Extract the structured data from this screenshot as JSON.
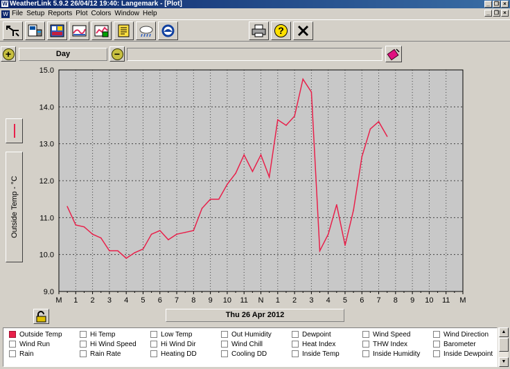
{
  "window": {
    "title": "WeatherLink 5.9.2  26/04/12  19:40: Langemark - [Plot]"
  },
  "menu": [
    "File",
    "Setup",
    "Reports",
    "Plot",
    "Colors",
    "Window",
    "Help"
  ],
  "toolbar": {
    "left_tools": [
      "walk-icon",
      "station-icon",
      "summary-icon",
      "bulletin-icon",
      "plot-icon",
      "notes-icon",
      "forecast-icon",
      "noaa-icon"
    ],
    "right_tools": [
      "print-icon",
      "help-icon",
      "close-icon"
    ],
    "help_glyph": "?",
    "close_glyph": "✕"
  },
  "controls": {
    "zoom_in_glyph": "+",
    "zoom_out_glyph": "−",
    "period": "Day",
    "field_text": ""
  },
  "chart_data": {
    "type": "line",
    "series": [
      {
        "name": "Outside Temp",
        "color": "#e8204a",
        "x_hours": [
          0.5,
          1,
          1.5,
          2,
          2.5,
          3,
          3.5,
          4,
          4.5,
          5,
          5.5,
          6,
          6.5,
          7,
          7.5,
          8,
          8.5,
          9,
          9.5,
          10,
          10.5,
          11,
          11.5,
          12,
          12.5,
          13,
          13.5,
          14,
          14.5,
          15,
          15.5,
          16,
          16.5,
          17,
          17.5,
          18,
          18.5,
          19,
          19.5
        ],
        "values": [
          11.3,
          10.8,
          10.75,
          10.55,
          10.45,
          10.1,
          10.1,
          9.9,
          10.05,
          10.15,
          10.55,
          10.65,
          10.4,
          10.55,
          10.6,
          10.65,
          11.25,
          11.5,
          11.5,
          11.9,
          12.2,
          12.7,
          12.25,
          12.7,
          12.1,
          13.65,
          13.5,
          13.75,
          14.75,
          14.4,
          10.1,
          10.55,
          11.35,
          10.25,
          11.2,
          12.65,
          13.4,
          13.6,
          13.2
        ]
      }
    ],
    "ylabel": "Outside Temp - °C",
    "ylim": [
      9.0,
      15.0
    ],
    "yticks": [
      "9.0",
      "10.0",
      "11.0",
      "12.0",
      "13.0",
      "14.0",
      "15.0"
    ],
    "xlim_hours": [
      0,
      24
    ],
    "xticks": [
      "M",
      "1",
      "2",
      "3",
      "4",
      "5",
      "6",
      "7",
      "8",
      "9",
      "10",
      "11",
      "N",
      "1",
      "2",
      "3",
      "4",
      "5",
      "6",
      "7",
      "8",
      "9",
      "10",
      "11",
      "M"
    ],
    "grid": true,
    "date_label": "Thu 26 Apr 2012"
  },
  "legend": {
    "rows": [
      [
        {
          "label": "Outside Temp",
          "checked": true
        },
        {
          "label": "Hi Temp",
          "checked": false
        },
        {
          "label": "Low Temp",
          "checked": false
        },
        {
          "label": "Out Humidity",
          "checked": false
        },
        {
          "label": "Dewpoint",
          "checked": false
        },
        {
          "label": "Wind Speed",
          "checked": false
        },
        {
          "label": "Wind Direction",
          "checked": false
        }
      ],
      [
        {
          "label": "Wind Run",
          "checked": false
        },
        {
          "label": "Hi Wind Speed",
          "checked": false
        },
        {
          "label": "Hi Wind Dir",
          "checked": false
        },
        {
          "label": "Wind Chill",
          "checked": false
        },
        {
          "label": "Heat Index",
          "checked": false
        },
        {
          "label": "THW Index",
          "checked": false
        },
        {
          "label": "Barometer",
          "checked": false
        }
      ],
      [
        {
          "label": "Rain",
          "checked": false
        },
        {
          "label": "Rain Rate",
          "checked": false
        },
        {
          "label": "Heating DD",
          "checked": false
        },
        {
          "label": "Cooling DD",
          "checked": false
        },
        {
          "label": "Inside Temp",
          "checked": false
        },
        {
          "label": "Inside Humidity",
          "checked": false
        },
        {
          "label": "Inside Dewpoint",
          "checked": false
        }
      ]
    ]
  },
  "colors": {
    "series": "#e8204a",
    "plot_bg": "#c8c8c8",
    "grid": "#404040",
    "titlebar": "#0a246a"
  }
}
